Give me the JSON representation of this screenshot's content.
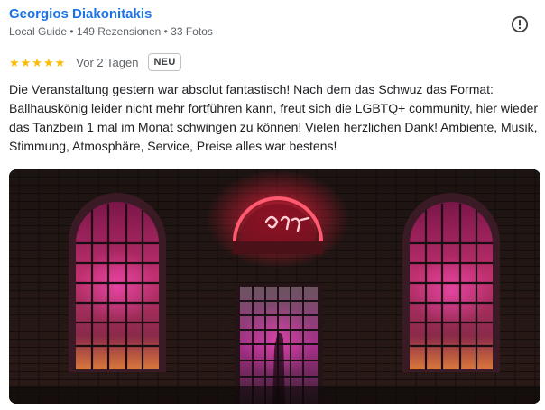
{
  "review": {
    "author_name": "Georgios Diakonitakis",
    "author_meta": "Local Guide • 149 Rezensionen • 33 Fotos",
    "stars": "★★★★★",
    "rating": 5,
    "date": "Vor 2 Tagen",
    "badge": "NEU",
    "text": "Die Veranstaltung gestern war absolut fantastisch! Nach dem das Schwuz das Format: Ballhauskönig leider nicht mehr fortführen kann, freut sich die LGBTQ+ community, hier wieder das Tanzbein 1 mal im Monat schwingen zu können! Vielen herzlichen Dank! Ambiente, Musik, Stimmung, Atmosphäre, Service, Preise alles war bestens!"
  },
  "icons": {
    "report": "report-flag-icon",
    "star": "star-icon"
  },
  "colors": {
    "author_link": "#1a73e8",
    "star": "#fbbc04",
    "meta_text": "#5f6368",
    "neon": "#ff3a5c"
  }
}
